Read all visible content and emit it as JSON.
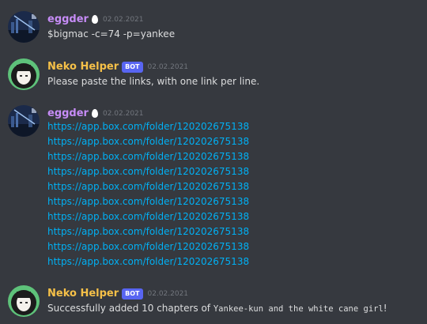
{
  "messages": [
    {
      "author": "eggder",
      "timestamp": "02.02.2021",
      "text": "$bigmac -c=74 -p=yankee"
    },
    {
      "author": "Neko Helper",
      "badge": "BOT",
      "timestamp": "02.02.2021",
      "text": "Please paste the links, with one link per line."
    },
    {
      "author": "eggder",
      "timestamp": "02.02.2021",
      "links": [
        "https://app.box.com/folder/120202675138",
        "https://app.box.com/folder/120202675138",
        "https://app.box.com/folder/120202675138",
        "https://app.box.com/folder/120202675138",
        "https://app.box.com/folder/120202675138",
        "https://app.box.com/folder/120202675138",
        "https://app.box.com/folder/120202675138",
        "https://app.box.com/folder/120202675138",
        "https://app.box.com/folder/120202675138",
        "https://app.box.com/folder/120202675138"
      ]
    },
    {
      "author": "Neko Helper",
      "badge": "BOT",
      "timestamp": "02.02.2021",
      "text_prefix": "Successfully added 10 chapters of ",
      "text_code": "Yankee-kun and the white cane girl",
      "text_suffix": "!"
    }
  ],
  "colors": {
    "background": "#36393f",
    "eggder_name": "#c68cf6",
    "neko_name": "#f5c048",
    "link": "#00b0f4",
    "bot_badge": "#5865f2",
    "timestamp": "#72767d"
  },
  "icons": {
    "eggder_avatar": "night-city-avatar",
    "neko_avatar": "anime-girl-avatar",
    "egg_emoji": "egg-icon"
  }
}
